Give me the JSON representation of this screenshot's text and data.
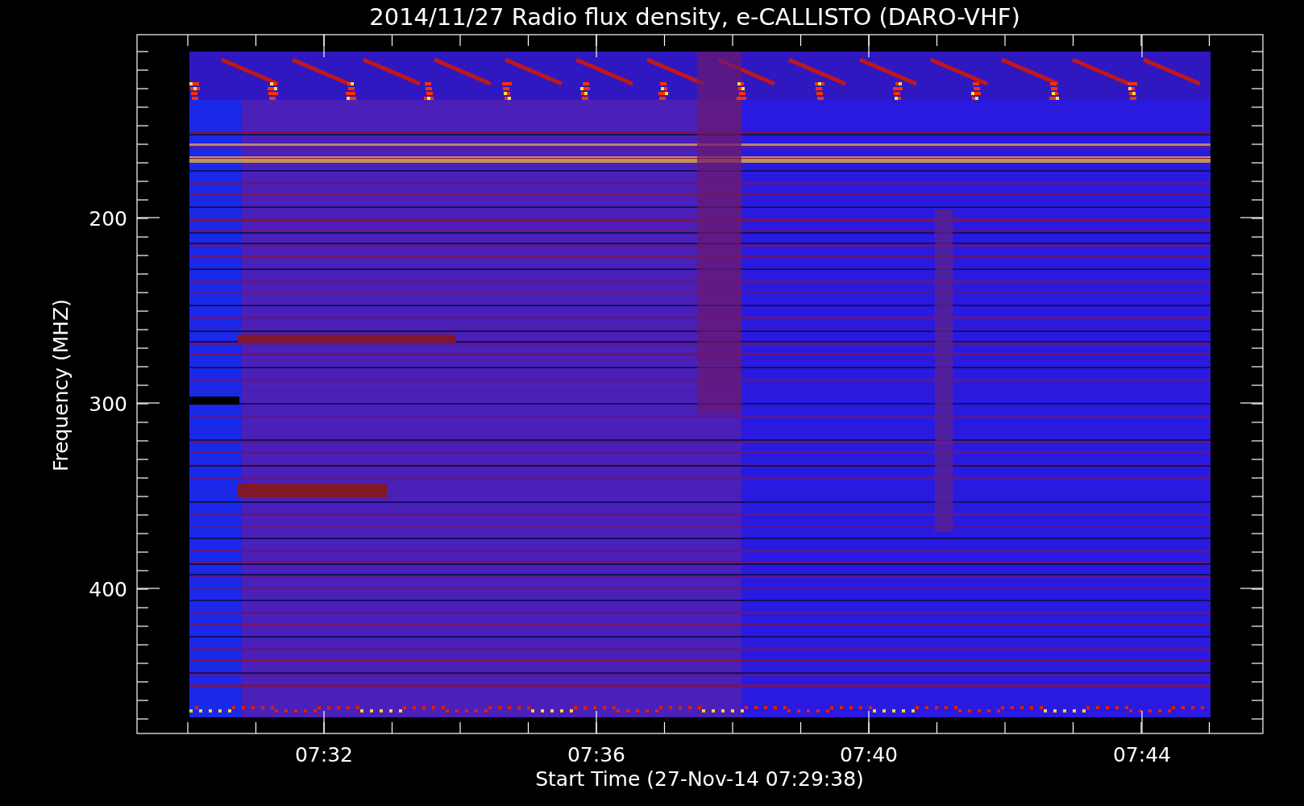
{
  "title": "2014/11/27  Radio flux density, e-CALLISTO (DARO-VHF)",
  "plot": {
    "ylabel": "Frequency (MHZ)",
    "xlabel": "Start Time (27-Nov-14 07:29:38)",
    "yticks": [
      "200",
      "300",
      "400"
    ],
    "xticks": [
      "07:32",
      "07:36",
      "07:40",
      "07:44"
    ]
  }
}
